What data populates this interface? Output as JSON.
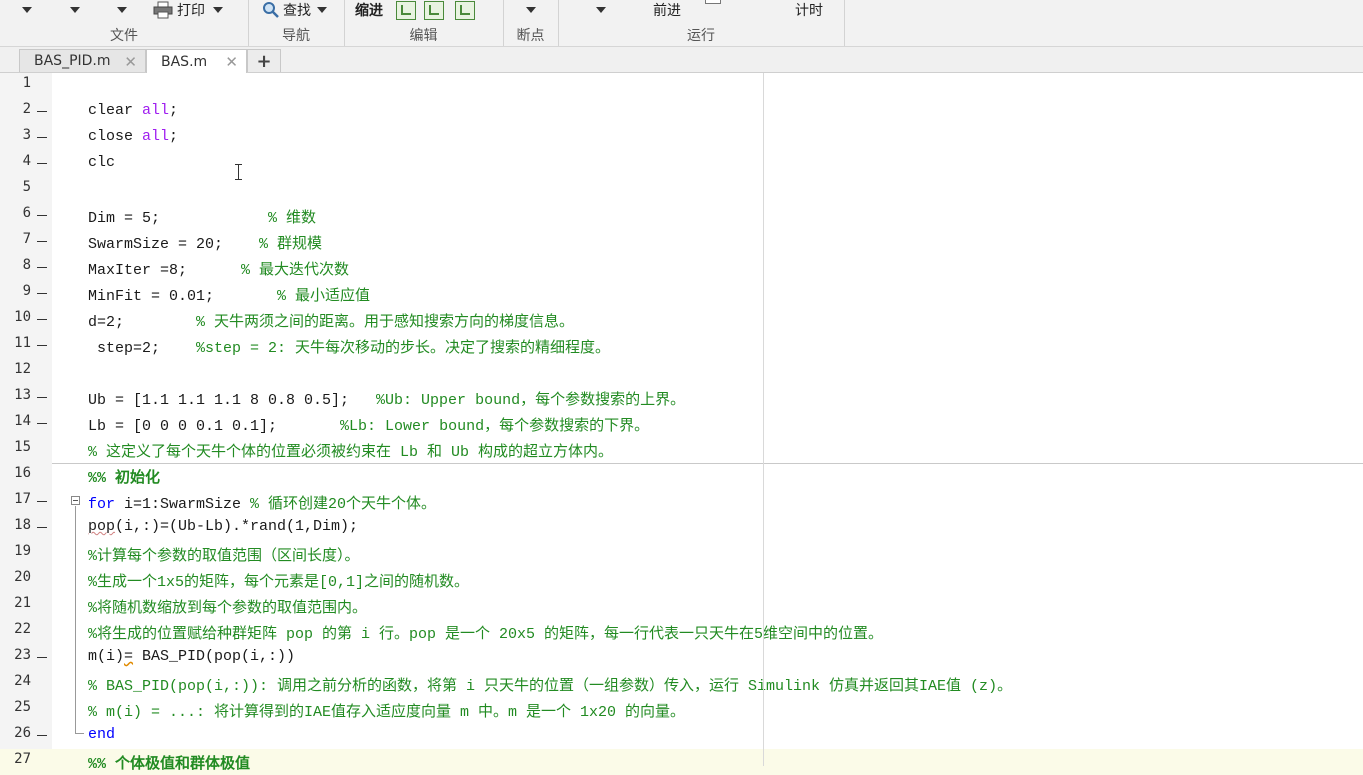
{
  "toolstrip": {
    "print_label": "打印",
    "find_label": "查找",
    "indent_label": "缩进",
    "forward_label": "前进",
    "timer_label": "计时",
    "groups": {
      "file": "文件",
      "navigate": "导航",
      "edit": "编辑",
      "breakpoints": "断点",
      "run": "运行"
    }
  },
  "tabs": [
    {
      "label": "BAS_PID.m",
      "active": false
    },
    {
      "label": "BAS.m",
      "active": true
    }
  ],
  "add_tab": "+",
  "editor": {
    "lines": [
      {
        "n": "1",
        "bp": false
      },
      {
        "n": "2",
        "bp": true,
        "a": "clear ",
        "b": "all",
        "c": ";"
      },
      {
        "n": "3",
        "bp": true,
        "a": "close ",
        "b": "all",
        "c": ";"
      },
      {
        "n": "4",
        "bp": true,
        "a": "clc"
      },
      {
        "n": "5",
        "bp": false
      },
      {
        "n": "6",
        "bp": true,
        "a": "Dim = 5;            ",
        "cm": "% 维数"
      },
      {
        "n": "7",
        "bp": true,
        "a": "SwarmSize = 20;    ",
        "cm": "% 群规模"
      },
      {
        "n": "8",
        "bp": true,
        "a": "MaxIter =8;      ",
        "cm": "% 最大迭代次数"
      },
      {
        "n": "9",
        "bp": true,
        "a": "MinFit = 0.01;       ",
        "cm": "% 最小适应值"
      },
      {
        "n": "10",
        "bp": true,
        "a": "d=2;        ",
        "cm": "% 天牛两须之间的距离。用于感知搜索方向的梯度信息。"
      },
      {
        "n": "11",
        "bp": true,
        "a": " step=2;    ",
        "cm": "%step = 2: 天牛每次移动的步长。决定了搜索的精细程度。"
      },
      {
        "n": "12",
        "bp": false
      },
      {
        "n": "13",
        "bp": true,
        "a": "Ub = [1.1 1.1 1.1 8 0.8 0.5];   ",
        "cm": "%Ub: Upper bound，每个参数搜索的上界。"
      },
      {
        "n": "14",
        "bp": true,
        "a": "Lb = [0 0 0 0.1 0.1];       ",
        "cm": "%Lb: Lower bound，每个参数搜索的下界。"
      },
      {
        "n": "15",
        "bp": false,
        "cm": "% 这定义了每个天牛个体的位置必须被约束在 Lb 和 Ub 构成的超立方体内。"
      },
      {
        "n": "16",
        "bp": false,
        "cell": "%% 初始化"
      },
      {
        "n": "17",
        "bp": true,
        "kw": "for",
        "a": " i=1:SwarmSize ",
        "cm": "% 循环创建20个天牛个体。"
      },
      {
        "n": "18",
        "bp": true,
        "a": "pop",
        "c": "(i,:)=(Ub-Lb).*rand(1,Dim);"
      },
      {
        "n": "19",
        "bp": false,
        "cm": "%计算每个参数的取值范围（区间长度）。"
      },
      {
        "n": "20",
        "bp": false,
        "cm": "%生成一个1x5的矩阵，每个元素是[0,1]之间的随机数。"
      },
      {
        "n": "21",
        "bp": false,
        "cm": "%将随机数缩放到每个参数的取值范围内。"
      },
      {
        "n": "22",
        "bp": false,
        "cm": "%将生成的位置赋给种群矩阵 pop 的第 i 行。pop 是一个 20x5 的矩阵，每一行代表一只天牛在5维空间中的位置。"
      },
      {
        "n": "23",
        "bp": true,
        "a": "m(i)",
        "w": "=",
        "c": " BAS_PID(pop(i,:))"
      },
      {
        "n": "24",
        "bp": false,
        "cm": "% BAS_PID(pop(i,:)): 调用之前分析的函数，将第 i 只天牛的位置（一组参数）传入，运行 Simulink 仿真并返回其IAE值 (z)。"
      },
      {
        "n": "25",
        "bp": false,
        "cm": "% m(i) = ...: 将计算得到的IAE值存入适应度向量 m 中。m 是一个 1x20 的向量。"
      },
      {
        "n": "26",
        "bp": true,
        "kw": "end"
      },
      {
        "n": "27",
        "bp": false,
        "cell": "%% 个体极值和群体极值"
      }
    ]
  }
}
